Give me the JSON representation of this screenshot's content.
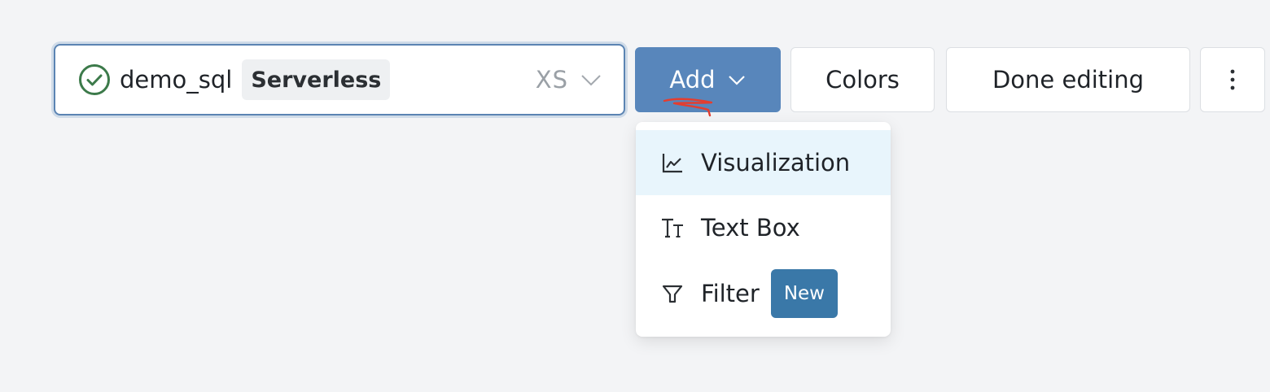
{
  "warehouse": {
    "status_icon": "check-circle-icon",
    "name": "demo_sql",
    "type_tag": "Serverless",
    "size": "XS",
    "chevron_icon": "chevron-down-icon"
  },
  "toolbar": {
    "add_label": "Add",
    "colors_label": "Colors",
    "done_label": "Done editing",
    "more_icon": "more-vertical-icon"
  },
  "add_menu": {
    "items": [
      {
        "label": "Visualization",
        "icon": "line-chart-icon",
        "highlighted": true
      },
      {
        "label": "Text Box",
        "icon": "text-format-icon"
      },
      {
        "label": "Filter",
        "icon": "filter-icon",
        "badge": "New"
      }
    ]
  },
  "colors": {
    "accent": "#5886bb",
    "badge": "#3a78a8",
    "success": "#3c7a4a",
    "highlight": "#e8f5fc"
  }
}
